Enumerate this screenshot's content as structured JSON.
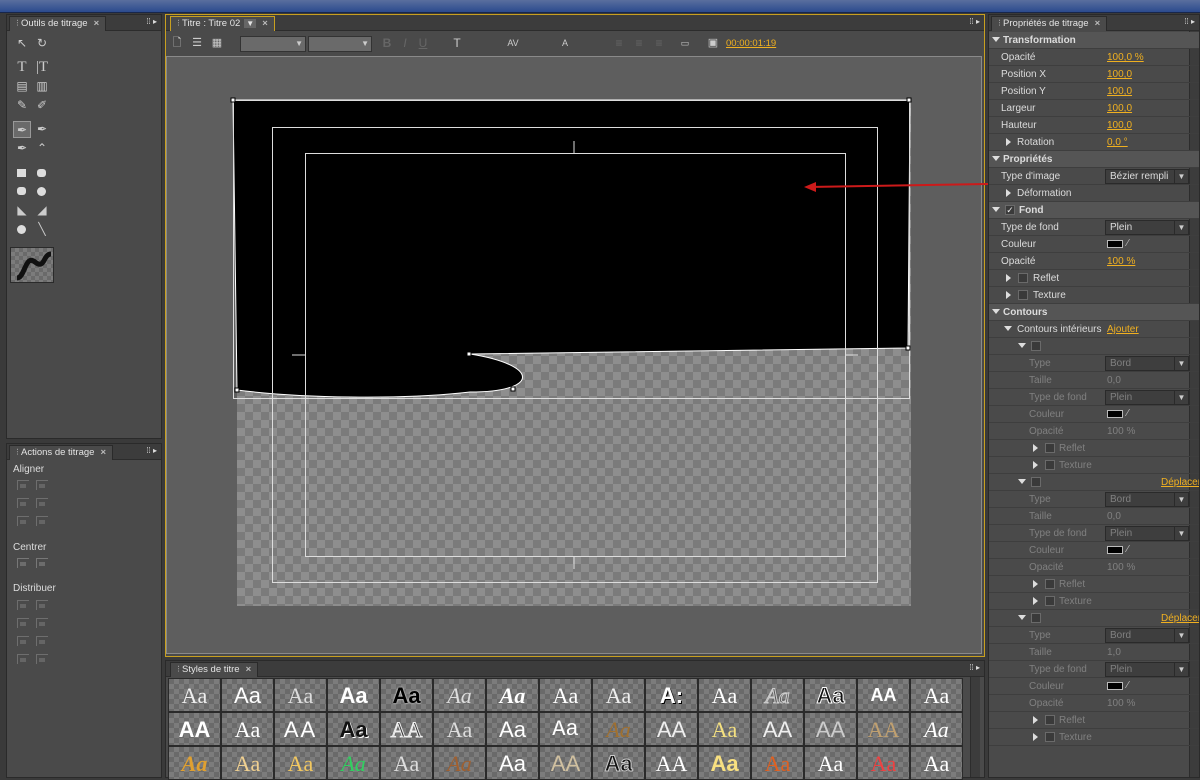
{
  "tools_panel": {
    "title": "Outils de titrage"
  },
  "actions_panel": {
    "title": "Actions de titrage",
    "align": "Aligner",
    "center": "Centrer",
    "distribute": "Distribuer"
  },
  "title_panel": {
    "tab": "Titre : Titre 02",
    "timecode": "00:00:01:19"
  },
  "styles_panel": {
    "title": "Styles de titre",
    "rows": [
      [
        "Aa",
        "Aa",
        "Aa",
        "Aa",
        "Aa",
        "Aa",
        "Aa",
        "Aa",
        "Aa",
        "A:",
        "Aa",
        "Aa",
        "Aa",
        "AA",
        "Aa"
      ],
      [
        "AA",
        "Aa",
        "AA",
        "Aa",
        "AA",
        "Aa",
        "Aa",
        "Aa",
        "Aa",
        "AA",
        "Aa",
        "AA",
        "AA",
        "AA",
        "Aa"
      ],
      [
        "Aa",
        "Aa",
        "Aa",
        "Aa",
        "Aa",
        "Aa",
        "Aa",
        "AA",
        "Aa",
        "AA",
        "Aa",
        "Aa",
        "Aa",
        "Aa",
        "Aa"
      ]
    ]
  },
  "props_panel": {
    "title": "Propriétés de titrage",
    "transformation": "Transformation",
    "opacity_label": "Opacité",
    "opacity_value": "100,0 %",
    "posx_label": "Position X",
    "posx_value": "100,0",
    "posy_label": "Position Y",
    "posy_value": "100,0",
    "width_label": "Largeur",
    "width_value": "100,0",
    "height_label": "Hauteur",
    "height_value": "100,0",
    "rotation_label": "Rotation",
    "rotation_value": "0,0 °",
    "properties": "Propriétés",
    "image_type_label": "Type d'image",
    "image_type_value": "Bézier rempli",
    "deformation": "Déformation",
    "fill": "Fond",
    "fill_type_label": "Type de fond",
    "fill_type_value": "Plein",
    "color_label": "Couleur",
    "fill_opacity_label": "Opacité",
    "fill_opacity_value": "100 %",
    "reflect": "Reflet",
    "texture": "Texture",
    "strokes": "Contours",
    "inner_strokes": "Contours intérieurs",
    "add": "Ajouter",
    "type_label": "Type",
    "type_value": "Bord",
    "size_label": "Taille",
    "size_value": "0,0",
    "size_value3": "1,0",
    "move": "Déplacer"
  }
}
